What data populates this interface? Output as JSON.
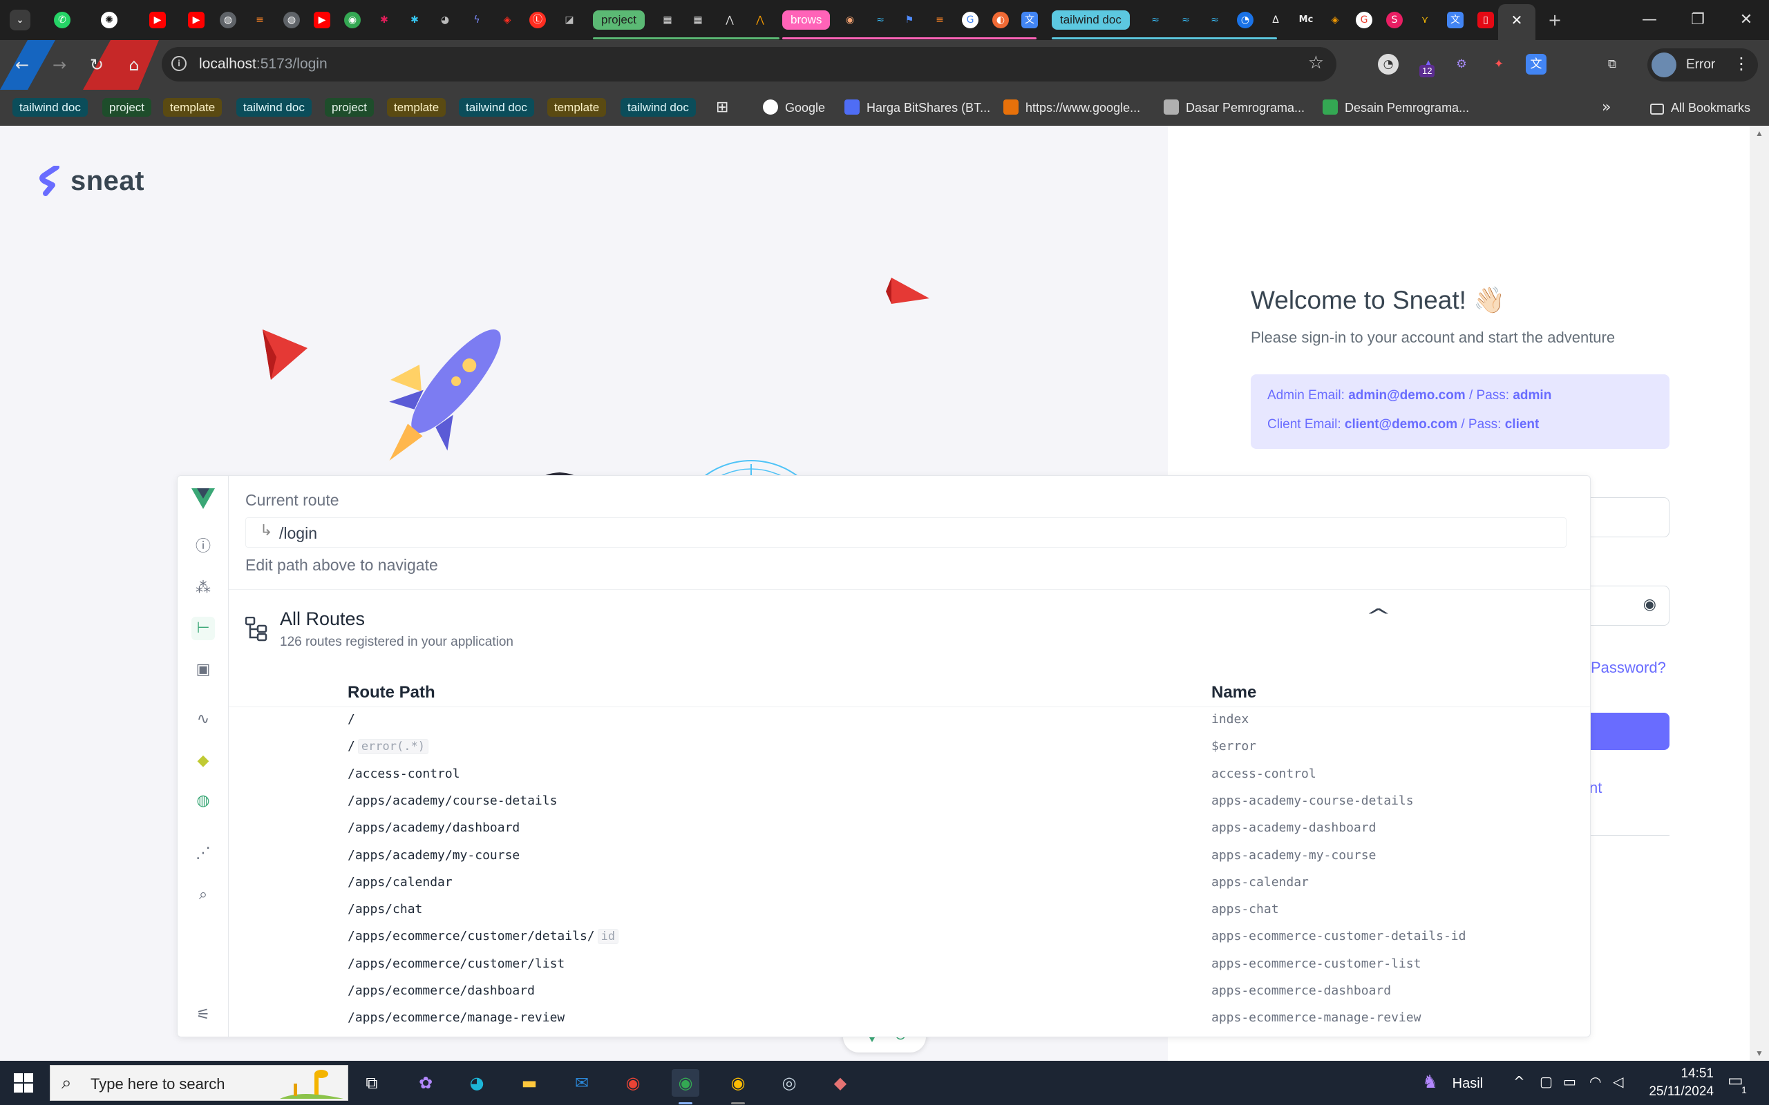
{
  "browser": {
    "tabs": {
      "groups": [
        {
          "label": "project",
          "bg": "#5bb974",
          "fg": "#1f1f1f"
        },
        {
          "label": "brows",
          "bg": "#ff63b8",
          "fg": "#ffffff"
        },
        {
          "label": "tailwind doc",
          "bg": "#5cc8e0",
          "fg": "#1f1f1f"
        }
      ]
    },
    "window_controls": {
      "minimize": "—",
      "restore": "❐",
      "close": "✕"
    },
    "address": {
      "host": "localhost",
      "rest": ":5173/login"
    },
    "profile_status": "Error",
    "extension_badge": "12",
    "bookmark_chips": [
      {
        "label": "tailwind doc",
        "bg": "#0b4d5a",
        "fg": "#e0f7fa"
      },
      {
        "label": "project",
        "bg": "#1e4d2b",
        "fg": "#e6f4ea"
      },
      {
        "label": "template",
        "bg": "#5a4a12",
        "fg": "#fdf3c7"
      },
      {
        "label": "tailwind doc",
        "bg": "#0b4d5a",
        "fg": "#e0f7fa"
      },
      {
        "label": "project",
        "bg": "#1e4d2b",
        "fg": "#e6f4ea"
      },
      {
        "label": "template",
        "bg": "#5a4a12",
        "fg": "#fdf3c7"
      },
      {
        "label": "tailwind doc",
        "bg": "#0b4d5a",
        "fg": "#e0f7fa"
      },
      {
        "label": "template",
        "bg": "#5a4a12",
        "fg": "#fdf3c7"
      },
      {
        "label": "tailwind doc",
        "bg": "#0b4d5a",
        "fg": "#e0f7fa"
      }
    ],
    "bookmarks": [
      {
        "label": "Google",
        "color": "#ffffff"
      },
      {
        "label": "Harga BitShares (BT...",
        "color": "#4f6df5"
      },
      {
        "label": "https://www.google...",
        "color": "#e8710a"
      },
      {
        "label": "Dasar Pemrograma...",
        "color": "#b0b0b0"
      },
      {
        "label": "Desain Pemrograma...",
        "color": "#34a853"
      }
    ],
    "all_bookmarks": "All Bookmarks"
  },
  "page": {
    "brand": "sneat",
    "welcome": "Welcome to Sneat! 👋🏻",
    "subtitle": "Please sign-in to your account and start the adventure",
    "credentials": {
      "admin_prefix": "Admin Email: ",
      "admin_email": "admin@demo.com",
      "admin_pass_prefix": " / Pass: ",
      "admin_pass": "admin",
      "client_prefix": "Client Email: ",
      "client_email": "client@demo.com",
      "client_pass_prefix": " / Pass: ",
      "client_pass": "client"
    },
    "forgot_fragment": "Password?",
    "create_fragment": "nt",
    "accent": "#696cff"
  },
  "devtools": {
    "current_route_label": "Current route",
    "current_route_value": "/login",
    "hint": "Edit path above to navigate",
    "all_routes_title": "All Routes",
    "all_routes_sub": "126 routes registered in your application",
    "col_path": "Route Path",
    "col_name": "Name",
    "routes": [
      {
        "path": "/",
        "param": "",
        "name": "index"
      },
      {
        "path": "/",
        "param": "error(.*)",
        "name": "$error"
      },
      {
        "path": "/access-control",
        "param": "",
        "name": "access-control"
      },
      {
        "path": "/apps/academy/course-details",
        "param": "",
        "name": "apps-academy-course-details"
      },
      {
        "path": "/apps/academy/dashboard",
        "param": "",
        "name": "apps-academy-dashboard"
      },
      {
        "path": "/apps/academy/my-course",
        "param": "",
        "name": "apps-academy-my-course"
      },
      {
        "path": "/apps/calendar",
        "param": "",
        "name": "apps-calendar"
      },
      {
        "path": "/apps/chat",
        "param": "",
        "name": "apps-chat"
      },
      {
        "path": "/apps/ecommerce/customer/details/",
        "param": "id",
        "name": "apps-ecommerce-customer-details-id"
      },
      {
        "path": "/apps/ecommerce/customer/list",
        "param": "",
        "name": "apps-ecommerce-customer-list"
      },
      {
        "path": "/apps/ecommerce/dashboard",
        "param": "",
        "name": "apps-ecommerce-dashboard"
      },
      {
        "path": "/apps/ecommerce/manage-review",
        "param": "",
        "name": "apps-ecommerce-manage-review"
      }
    ],
    "accent": "#3aa776"
  },
  "taskbar": {
    "search_placeholder": "Type here to search",
    "weather_label": "Hasil",
    "time": "14:51",
    "date": "25/11/2024",
    "notification_count": "1"
  }
}
